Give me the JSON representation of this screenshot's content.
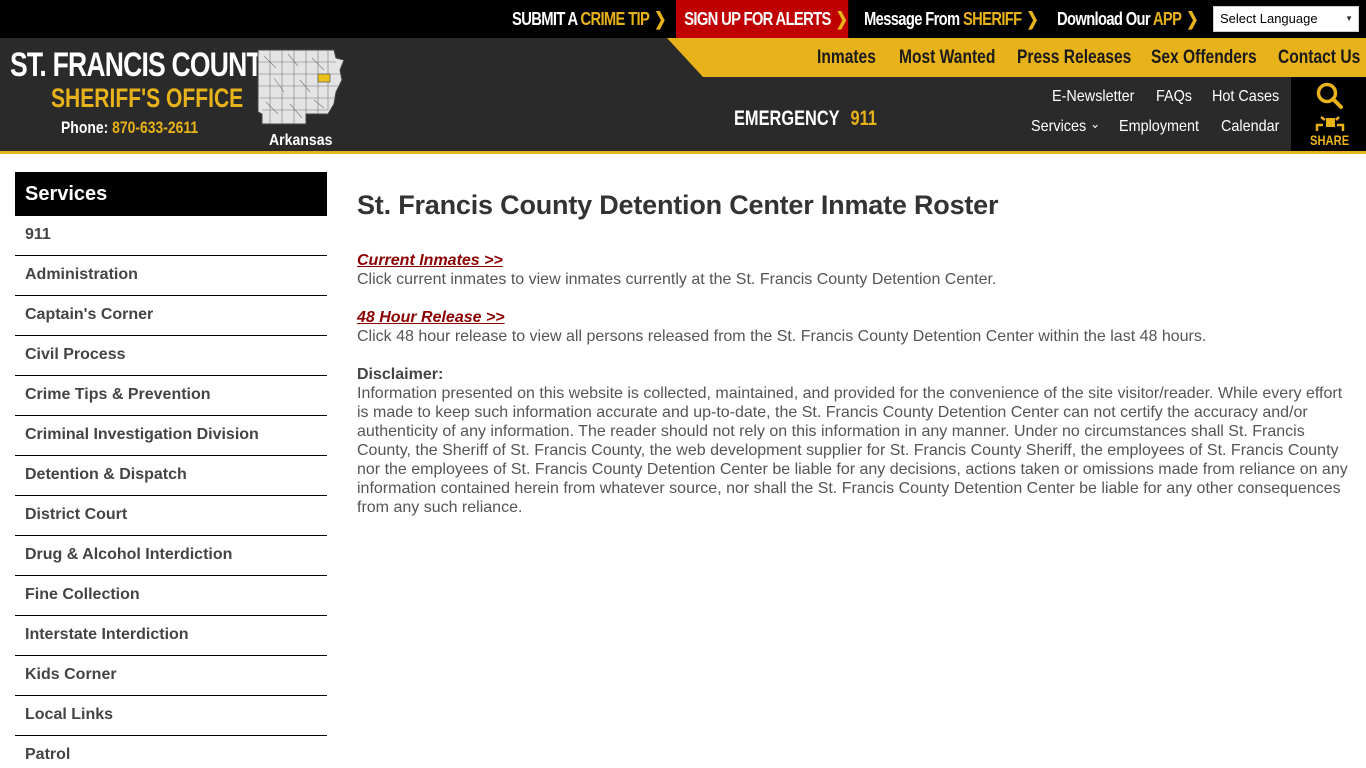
{
  "topbar": {
    "crime_tip": {
      "prefix": "SUBMIT A ",
      "accent": "CRIME TIP",
      "chevron": "❯"
    },
    "alerts": {
      "label": "SIGN UP FOR ALERTS",
      "chevron": "❯"
    },
    "sheriff_msg": {
      "prefix": "Message From ",
      "accent": "SHERIFF",
      "chevron": "❯"
    },
    "app": {
      "prefix": "Download Our ",
      "accent": "APP",
      "chevron": "❯"
    },
    "language": {
      "selected": "Select Language",
      "caret": "▼"
    }
  },
  "header": {
    "title": "ST. FRANCIS COUNTY",
    "subtitle": "SHERIFF'S OFFICE",
    "phone_label": "Phone: ",
    "phone_number": "870-633-2611",
    "state_label": "Arkansas",
    "emergency_label": "EMERGENCY",
    "emergency_number": "911"
  },
  "main_nav": [
    "Inmates",
    "Most Wanted",
    "Press Releases",
    "Sex Offenders",
    "Contact Us"
  ],
  "sub_nav": {
    "row1": [
      "E-Newsletter",
      "FAQs",
      "Hot Cases"
    ],
    "services": "Services",
    "services_chevron": "⌄",
    "employment": "Employment",
    "calendar": "Calendar"
  },
  "icons": {
    "share_label": "SHARE"
  },
  "colors": {
    "accent_yellow": "#e8b21a",
    "alert_red": "#c00000",
    "link_red": "#8b0000",
    "header_dark": "#2a2a2a"
  },
  "sidebar": {
    "title": "Services",
    "items": [
      "911",
      "Administration",
      "Captain's Corner",
      "Civil Process",
      "Crime Tips & Prevention",
      "Criminal Investigation Division",
      "Detention & Dispatch",
      "District Court",
      "Drug & Alcohol Interdiction",
      "Fine Collection",
      "Interstate Interdiction",
      "Kids Corner",
      "Local Links",
      "Patrol"
    ]
  },
  "content": {
    "title": "St. Francis County Detention Center Inmate Roster",
    "current_inmates_link": "Current Inmates >>",
    "current_inmates_desc": "Click current inmates to view inmates currently at the St. Francis County Detention Center.",
    "release_link": "48 Hour Release >>",
    "release_desc": "Click 48 hour release to view all persons released from the St. Francis County Detention Center within the last 48 hours.",
    "disclaimer_heading": "Disclaimer:",
    "disclaimer_body": "Information presented on this website is collected, maintained, and provided for the convenience of the site visitor/reader. While every effort is made to keep such information accurate and up-to-date, the St. Francis County Detention Center can not certify the accuracy and/or authenticity of any information. The reader should not rely on this information in any manner.  Under no circumstances shall St. Francis County, the Sheriff of St. Francis County, the web development supplier for St. Francis County Sheriff, the employees of St. Francis County nor the employees of St. Francis County Detention Center be liable for any decisions, actions taken or omissions made from reliance on any information contained herein from whatever source, nor shall the St. Francis County Detention Center be liable for any other consequences from any such reliance."
  }
}
